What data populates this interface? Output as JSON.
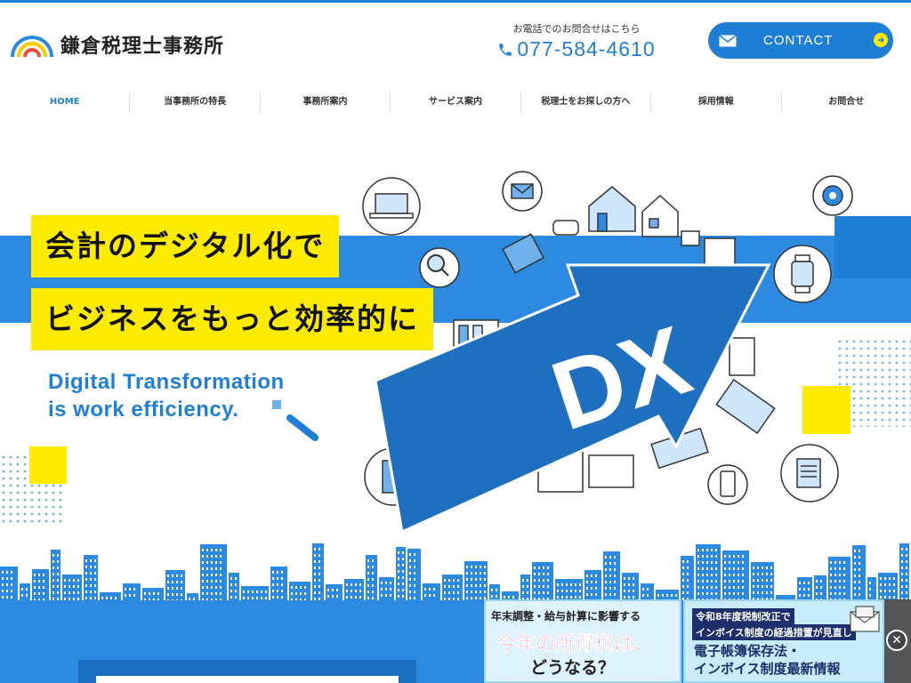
{
  "header": {
    "logo_text": "鎌倉税理士事務所",
    "phone_label": "お電話でのお問合せはこちら",
    "phone_number": "077-584-4610",
    "contact_label": "CONTACT"
  },
  "nav": {
    "items": [
      {
        "label": "HOME"
      },
      {
        "label": "当事務所の特長"
      },
      {
        "label": "事務所案内"
      },
      {
        "label": "サービス案内"
      },
      {
        "label": "税理士をお探しの方へ"
      },
      {
        "label": "採用情報"
      },
      {
        "label": "お問合せ"
      }
    ]
  },
  "hero": {
    "catch1": "会計のデジタル化で",
    "catch2": "ビジネスをもっと効率的に",
    "sub_en_line1": "Digital Transformation",
    "sub_en_line2": "is work efficiency.",
    "arrow_text": "DX"
  },
  "banners": {
    "tax": {
      "top": "年末調整・給与計算に影響する",
      "main": "今年の所得税は、",
      "sub": "どうなる？"
    },
    "invoice": {
      "tag1": "令和8年度税制改正で",
      "tag2": "インボイス制度の経過措置が見直し",
      "main1": "電子帳簿保存法・",
      "main2": "インボイス制度最新情報"
    },
    "close_symbol": "✕"
  },
  "colors": {
    "brand_blue": "#1f7fd6",
    "band_blue": "#2c8be0",
    "accent_yellow": "#ffeb00"
  }
}
